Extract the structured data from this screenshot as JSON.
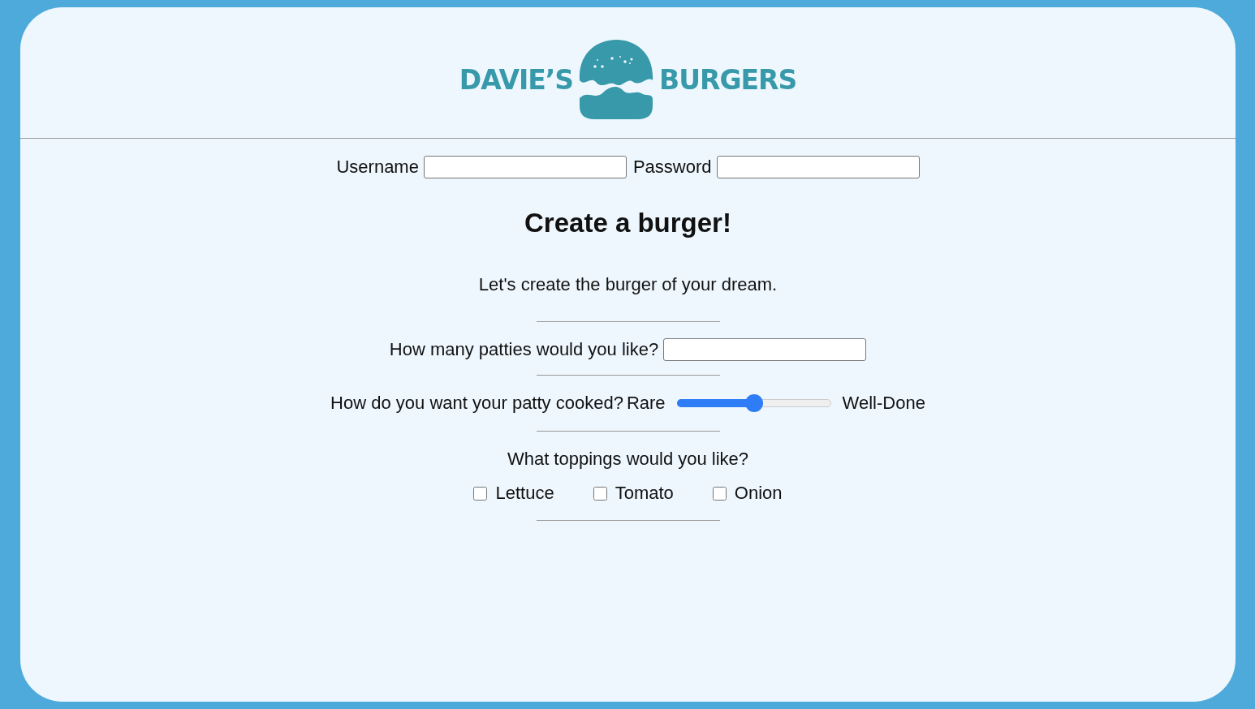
{
  "logo": {
    "left_word": "DAVIE’S",
    "right_word": "BURGERS"
  },
  "login": {
    "username_label": "Username",
    "password_label": "Password"
  },
  "title": "Create a burger!",
  "intro": "Let's create the burger of your dream.",
  "patties": {
    "label": "How many patties would you like?"
  },
  "cooking": {
    "label": "How do you want your patty cooked?",
    "min_label": "Rare",
    "max_label": "Well-Done",
    "level": 0.5
  },
  "toppings": {
    "label": "What toppings would you like?",
    "items": [
      {
        "label": "Lettuce",
        "checked": false
      },
      {
        "label": "Tomato",
        "checked": false
      },
      {
        "label": "Onion",
        "checked": false
      }
    ]
  }
}
